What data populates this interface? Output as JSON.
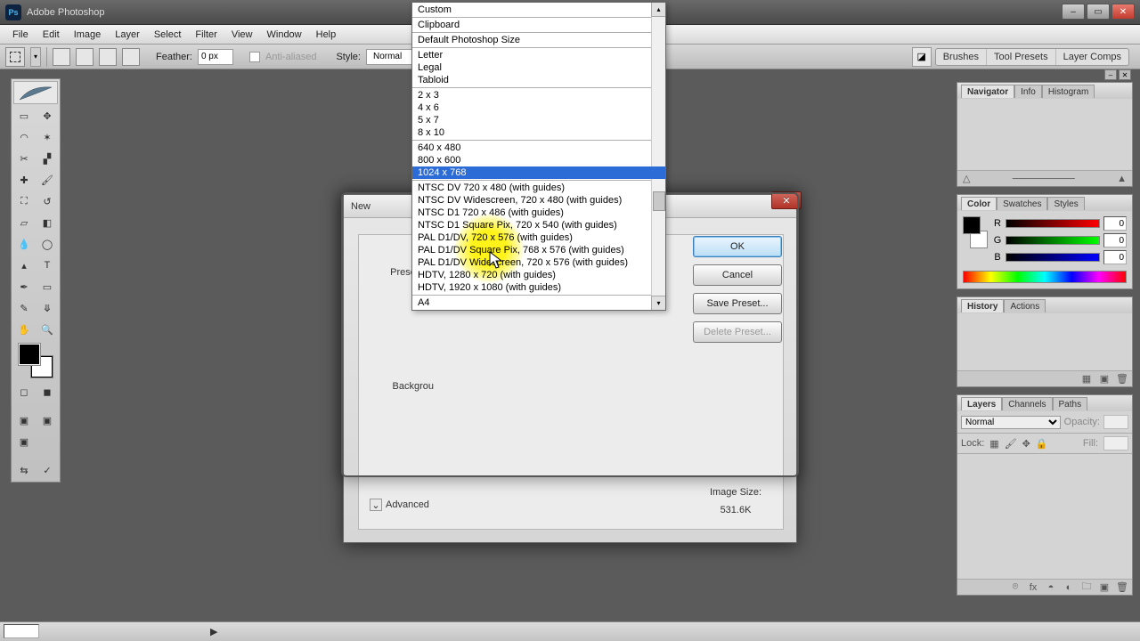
{
  "app": {
    "title": "Adobe Photoshop"
  },
  "winbtns": {
    "min": "–",
    "max": "▭",
    "close": "✕"
  },
  "menu": [
    "File",
    "Edit",
    "Image",
    "Layer",
    "Select",
    "Filter",
    "View",
    "Window",
    "Help"
  ],
  "options": {
    "feather_label": "Feather:",
    "feather_value": "0 px",
    "antialias": "Anti-aliased",
    "style_label": "Style:",
    "style_value": "Normal",
    "right_tabs": [
      "Brushes",
      "Tool Presets",
      "Layer Comps"
    ]
  },
  "dialog": {
    "title": "New",
    "preset_label": "Preset:",
    "background_label": "Backgrou",
    "advanced": "Advanced",
    "buttons": {
      "ok": "OK",
      "cancel": "Cancel",
      "save": "Save Preset...",
      "delete": "Delete Preset..."
    },
    "image_size_label": "Image Size:",
    "image_size_value": "531.6K"
  },
  "dropdown": {
    "g1": [
      "Custom"
    ],
    "g2": [
      "Clipboard"
    ],
    "g3": [
      "Default Photoshop Size"
    ],
    "g4": [
      "Letter",
      "Legal",
      "Tabloid"
    ],
    "g5": [
      "2 x 3",
      "4 x 6",
      "5 x 7",
      "8 x 10"
    ],
    "g6": [
      "640 x 480",
      "800 x 600",
      "1024 x 768"
    ],
    "g7": [
      "NTSC DV 720 x 480 (with guides)",
      "NTSC DV Widescreen, 720 x 480 (with guides)",
      "NTSC D1 720 x 486 (with guides)",
      "NTSC D1 Square Pix, 720 x 540 (with guides)",
      "PAL D1/DV, 720 x 576 (with guides)",
      "PAL D1/DV Square Pix, 768 x 576 (with guides)",
      "PAL D1/DV Widescreen, 720 x 576 (with guides)",
      "HDTV, 1280 x 720 (with guides)",
      "HDTV, 1920 x 1080 (with guides)"
    ],
    "g8": [
      "A4"
    ],
    "selected": "1024 x 768"
  },
  "panels": {
    "nav": {
      "tabs": [
        "Navigator",
        "Info",
        "Histogram"
      ]
    },
    "color": {
      "tabs": [
        "Color",
        "Swatches",
        "Styles"
      ],
      "channels": [
        {
          "lbl": "R",
          "val": "0",
          "grad": "linear-gradient(90deg,#000,#f00)"
        },
        {
          "lbl": "G",
          "val": "0",
          "grad": "linear-gradient(90deg,#000,#0f0)"
        },
        {
          "lbl": "B",
          "val": "0",
          "grad": "linear-gradient(90deg,#000,#00f)"
        }
      ]
    },
    "history": {
      "tabs": [
        "History",
        "Actions"
      ]
    },
    "layers": {
      "tabs": [
        "Layers",
        "Channels",
        "Paths"
      ],
      "blend": "Normal",
      "opacity_label": "Opacity:",
      "lock_label": "Lock:",
      "fill_label": "Fill:"
    }
  },
  "nav_bottom": {
    "left": "▲",
    "right": "△  ─────  △"
  }
}
